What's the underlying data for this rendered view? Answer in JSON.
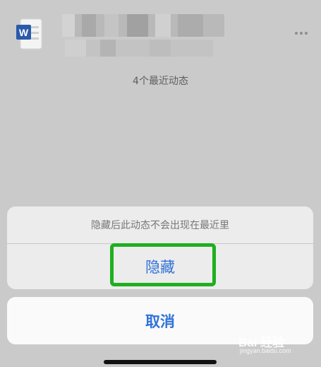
{
  "file_row": {
    "app_icon": "word-document-icon",
    "icon_letter": "W",
    "more_icon": "more-horizontal-icon"
  },
  "recent_count_text": "4个最近动态",
  "action_sheet": {
    "message": "隐藏后此动态不会出现在最近里",
    "hide_label": "隐藏",
    "cancel_label": "取消",
    "action_color": "#2f72d9",
    "highlight_color": "#1faf1f"
  },
  "watermark": {
    "logo_text": "Bai 经验",
    "sub_text": "jingyan.baidu.com"
  }
}
